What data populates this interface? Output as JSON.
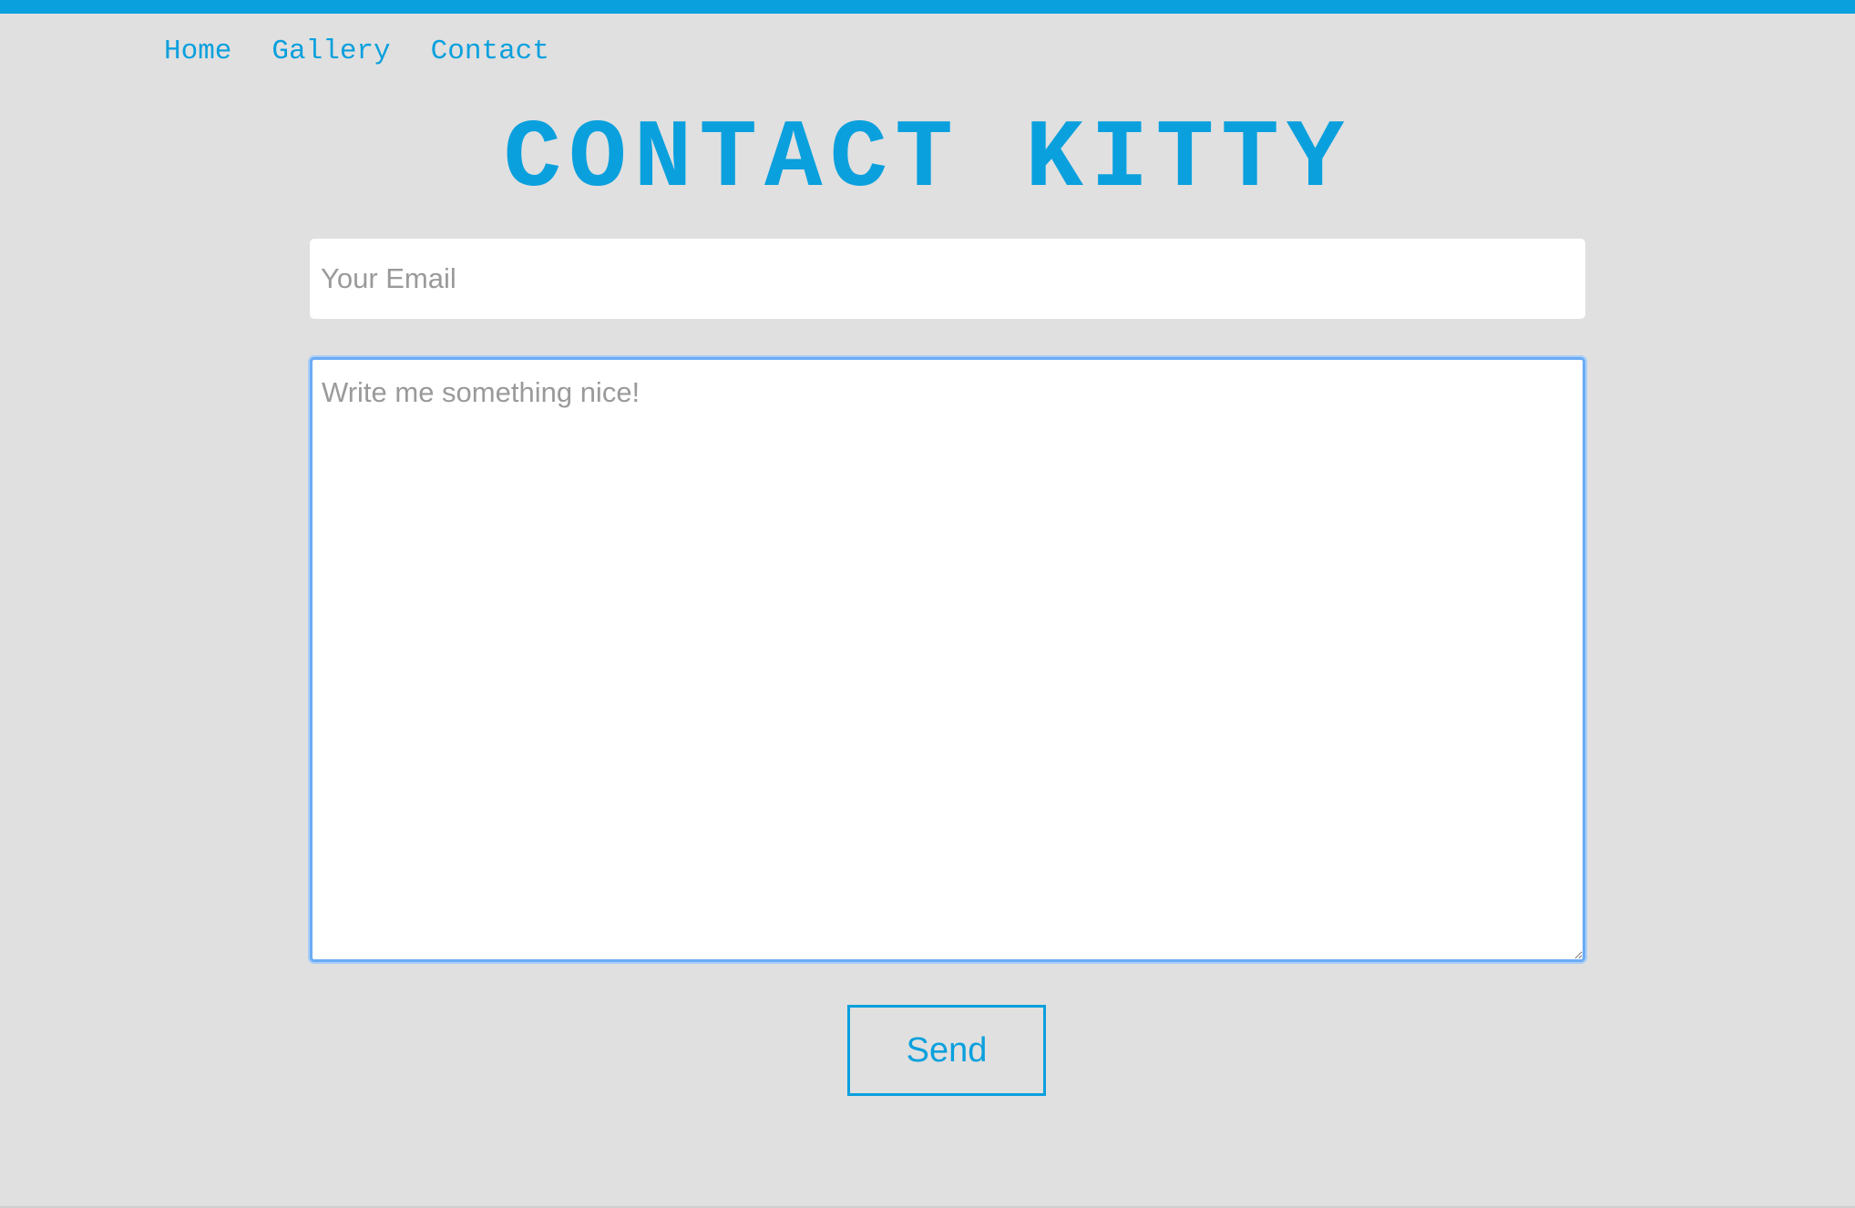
{
  "nav": {
    "items": [
      {
        "label": "Home"
      },
      {
        "label": "Gallery"
      },
      {
        "label": "Contact"
      }
    ]
  },
  "page": {
    "title": "CONTACT KITTY"
  },
  "form": {
    "email_placeholder": "Your Email",
    "email_value": "",
    "message_placeholder": "Write me something nice!",
    "message_value": "",
    "send_label": "Send"
  },
  "colors": {
    "accent": "#0aa0dd",
    "background": "#e0e0e0",
    "focus_ring": "#6aacf5"
  }
}
